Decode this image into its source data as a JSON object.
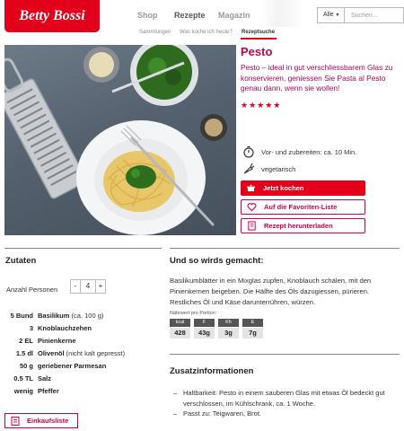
{
  "header": {
    "logo": "Betty Bossi",
    "nav": [
      "Shop",
      "Rezepte",
      "Magazin"
    ],
    "search": {
      "select": "Alle",
      "placeholder": "Suchen..."
    },
    "subnav": [
      "Sammlungen",
      "Was koche ich heute?",
      "Rezeptsuche"
    ]
  },
  "recipe": {
    "title": "Pesto",
    "lead": "Pesto – ideal in gut verschliessbarem Glas zu konservieren, geniessen Sie Pasta al Pesto genau dann, wenn sie wollen!",
    "rating": 5,
    "stars": "★★★★★",
    "time": "Vor- und zubereiten: ca. 10 Min.",
    "diet": "vegetarisch",
    "buttons": {
      "cook": "Jetzt kochen",
      "favorite": "Auf die Favoriten-Liste",
      "download": "Rezept herunterladen"
    }
  },
  "ingredients": {
    "title": "Zutaten",
    "persons_label": "Anzahl Personen",
    "persons_minus": "-",
    "persons_value": "4",
    "persons_plus": "+",
    "items": [
      {
        "qty": "5 Bund",
        "name": "Basilikum",
        "note": " (ca. 100 g)"
      },
      {
        "qty": "3",
        "name": "Knoblauchzehen",
        "note": ""
      },
      {
        "qty": "2 EL",
        "name": "Pinienkerne",
        "note": ""
      },
      {
        "qty": "1.5 dl",
        "name": "Olivenöl",
        "note": " (nicht kalt gepresst)"
      },
      {
        "qty": "50 g",
        "name": "geriebener Parmesan",
        "note": ""
      },
      {
        "qty": "0.5 TL",
        "name": "Salz",
        "note": ""
      },
      {
        "qty": "wenig",
        "name": "Pfeffer",
        "note": ""
      }
    ],
    "shopping_button": "Einkaufsliste"
  },
  "method": {
    "title": "Und so wirds gemacht:",
    "text": "Basilikumblätter in ein Mixglas zupfen, Knoblauch schälen, mit den Pinienkernen beigeben. Die Hälfte des Öls dazugiessen, pürieren. Restliches Öl und Käse darunterrühren, würzen.",
    "nutrition_label": "Nährwert pro Portion:",
    "nutrition": [
      {
        "head": "kcal",
        "value": "428"
      },
      {
        "head": "F",
        "value": "43g"
      },
      {
        "head": "Kh",
        "value": "3g"
      },
      {
        "head": "E",
        "value": "7g"
      }
    ]
  },
  "additional": {
    "title": "Zusatzinformationen",
    "items": [
      "Haltbarkeit: Pesto in einem sauberen Glas mit etwas Öl bedeckt gut verschlossen, im Kühlschrank, ca. 1 Woche.",
      "Passt zu: Teigwaren, Brot."
    ]
  },
  "colors": {
    "brand_red": "#e2001a",
    "accent_magenta": "#c8004f"
  }
}
